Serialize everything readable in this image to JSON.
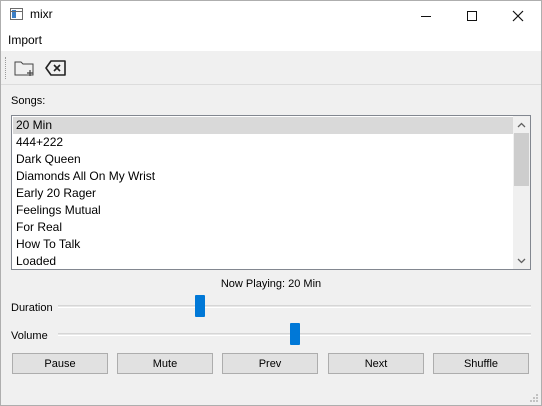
{
  "window": {
    "title": "mixr"
  },
  "menu": {
    "items": [
      {
        "label": "Import"
      }
    ]
  },
  "toolbar": {
    "buttons": [
      {
        "icon": "add-folder-icon"
      },
      {
        "icon": "backspace-delete-icon"
      }
    ]
  },
  "songs": {
    "label": "Songs:",
    "items": [
      "20 Min",
      "444+222",
      "Dark Queen",
      "Diamonds All On My Wrist",
      "Early 20 Rager",
      "Feelings Mutual",
      "For Real",
      "How To Talk",
      "Loaded"
    ],
    "selected_index": 0
  },
  "now_playing": "Now Playing: 20 Min",
  "sliders": {
    "duration": {
      "label": "Duration",
      "value_percent": 30
    },
    "volume": {
      "label": "Volume",
      "value_percent": 50
    }
  },
  "buttons": {
    "pause": "Pause",
    "mute": "Mute",
    "prev": "Prev",
    "next": "Next",
    "shuffle": "Shuffle"
  },
  "colors": {
    "accent": "#0078d7",
    "selection": "#d9d9d9"
  }
}
